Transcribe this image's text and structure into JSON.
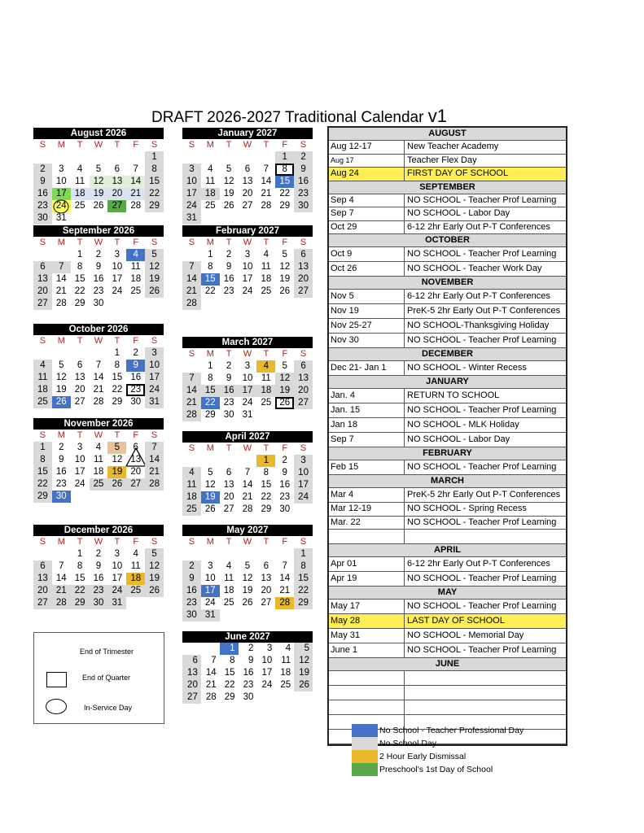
{
  "title": {
    "main": "DRAFT 2026-2027 Traditional Calendar ",
    "version": "v1"
  },
  "dow": [
    "S",
    "M",
    "T",
    "W",
    "T",
    "F",
    "S"
  ],
  "months": [
    {
      "name": "August  2026",
      "offset": 6,
      "days": 31,
      "styles": {
        "1": "gray",
        "2": "gray",
        "8": "gray",
        "9": "gray",
        "12": "lgreen",
        "13": "lgreen",
        "14": "lgreen",
        "15": "gray",
        "16": "gray",
        "17": "lime",
        "18": "lblue",
        "19": "lblue",
        "20": "lblue",
        "21": "lblue",
        "22": "gray",
        "23": "gray",
        "24": "yellow circled",
        "27": "green",
        "29": "gray",
        "30": "gray"
      }
    },
    {
      "name": "September  2026",
      "offset": 2,
      "days": 30,
      "styles": {
        "4": "blue",
        "5": "gray",
        "6": "gray",
        "7": "gray",
        "12": "gray",
        "13": "gray",
        "19": "gray",
        "20": "gray",
        "26": "gray",
        "27": "gray"
      }
    },
    {
      "name": "October  2026",
      "offset": 4,
      "days": 31,
      "styles": {
        "3": "gray",
        "4": "gray",
        "9": "blue",
        "10": "gray",
        "11": "gray",
        "17": "gray",
        "18": "gray",
        "23": "boxed",
        "24": "gray",
        "25": "gray",
        "26": "blue",
        "31": "gray"
      }
    },
    {
      "name": "November  2026",
      "offset": 0,
      "days": 30,
      "styles": {
        "1": "gray",
        "5": "tan",
        "7": "gray",
        "8": "gray",
        "13": "tri",
        "14": "gray",
        "15": "gray",
        "19": "gold",
        "21": "gray",
        "22": "gray",
        "25": "gray",
        "26": "gray",
        "27": "gray",
        "28": "gray",
        "29": "gray",
        "30": "blue"
      }
    },
    {
      "name": "December  2026",
      "offset": 2,
      "days": 31,
      "styles": {
        "5": "gray",
        "6": "gray",
        "12": "gray",
        "13": "gray",
        "18": "gold",
        "19": "gray",
        "20": "gray",
        "21": "gray",
        "22": "gray",
        "23": "gray",
        "24": "gray",
        "25": "gray",
        "26": "gray",
        "27": "gray",
        "28": "gray",
        "29": "gray",
        "30": "gray",
        "31": "gray"
      }
    },
    {
      "name": "January  2027",
      "offset": 5,
      "days": 31,
      "styles": {
        "1": "gray",
        "2": "gray",
        "3": "gray",
        "8": "boxed",
        "9": "gray",
        "10": "gray",
        "15": "blue",
        "16": "gray",
        "17": "gray",
        "18": "gray",
        "23": "gray",
        "24": "gray",
        "30": "gray",
        "31": "gray"
      }
    },
    {
      "name": "February  2027",
      "offset": 1,
      "days": 28,
      "styles": {
        "6": "gray",
        "7": "gray",
        "13": "gray",
        "14": "gray",
        "15": "blue",
        "20": "gray",
        "21": "gray",
        "27": "gray",
        "28": "gray"
      }
    },
    {
      "name": "March  2027",
      "offset": 1,
      "days": 31,
      "styles": {
        "4": "gold",
        "6": "gray",
        "7": "gray",
        "12": "gray",
        "13": "gray",
        "14": "gray",
        "15": "gray",
        "16": "gray",
        "17": "gray",
        "18": "gray",
        "19": "gray",
        "20": "gray",
        "21": "gray",
        "22": "blue",
        "26": "boxed",
        "27": "gray",
        "28": "gray"
      }
    },
    {
      "name": "April  2027",
      "offset": 4,
      "days": 30,
      "styles": {
        "1": "gold",
        "3": "gray",
        "4": "gray",
        "10": "gray",
        "11": "gray",
        "17": "gray",
        "18": "gray",
        "19": "blue",
        "24": "gray",
        "25": "gray"
      }
    },
    {
      "name": "May  2027",
      "offset": 6,
      "days": 31,
      "styles": {
        "1": "gray",
        "2": "gray",
        "8": "gray",
        "9": "gray",
        "15": "gray",
        "16": "gray",
        "17": "blue",
        "22": "gray",
        "23": "gray",
        "28": "gold",
        "29": "gray",
        "30": "gray",
        "31": "gray"
      }
    },
    {
      "name": "June 2027",
      "offset": 2,
      "days": 30,
      "nodow": true,
      "styles": {
        "1": "blue",
        "5": "gray",
        "6": "gray",
        "12": "gray",
        "13": "gray",
        "19": "gray",
        "20": "gray",
        "26": "gray",
        "27": "gray"
      }
    }
  ],
  "events": [
    {
      "section": "AUGUST"
    },
    {
      "date": "Aug 12-17",
      "event": "New Teacher Academy"
    },
    {
      "date": "Aug 17",
      "event": "Teacher Flex Day",
      "small": true
    },
    {
      "date": "Aug 24",
      "event": "FIRST DAY OF SCHOOL",
      "highlight": true
    },
    {
      "section": "SEPTEMBER"
    },
    {
      "date": "Sep 4",
      "event": "NO SCHOOL - Teacher Prof Learning"
    },
    {
      "date": "Sep 7",
      "event": "NO SCHOOL - Labor Day"
    },
    {
      "date": "Oct 29",
      "event": "6-12 2hr Early Out P-T Conferences"
    },
    {
      "section": "OCTOBER"
    },
    {
      "date": "Oct 9",
      "event": "NO SCHOOL - Teacher Prof Learning",
      "tall": true
    },
    {
      "date": "Oct 26",
      "event": "NO SCHOOL - Teacher Work Day",
      "tall": true
    },
    {
      "section": "NOVEMBER"
    },
    {
      "date": "Nov 5",
      "event": "6-12 2hr Early Out P-T Conferences",
      "tall": true
    },
    {
      "date": "Nov 19",
      "event": "PreK-5 2hr Early Out P-T Conferences",
      "tall": true
    },
    {
      "date": "Nov 25-27",
      "event": "NO SCHOOL-Thanksgiving Holiday",
      "tall": true
    },
    {
      "date": "Nov 30",
      "event": "NO SCHOOL - Teacher Prof Learning",
      "tall": true
    },
    {
      "section": "DECEMBER"
    },
    {
      "date": "Dec 21- Jan 1",
      "event": "NO SCHOOL - Winter Recess",
      "tall": true
    },
    {
      "section": "JANUARY"
    },
    {
      "date": "Jan. 4",
      "event": "RETURN TO SCHOOL",
      "tall": true
    },
    {
      "date": "Jan. 15",
      "event": "NO SCHOOL - Teacher Prof Learning",
      "tall": true
    },
    {
      "date": "Jan 18",
      "event": "NO SCHOOL - MLK Holiday",
      "tall": true
    },
    {
      "date": "Sep 7",
      "event": "NO SCHOOL - Labor Day",
      "tall": true
    },
    {
      "section": "FEBRUARY"
    },
    {
      "date": "Feb 15",
      "event": "NO SCHOOL - Teacher Prof Learning",
      "tall": true
    },
    {
      "section": "MARCH"
    },
    {
      "date": "Mar 4",
      "event": "PreK-5 2hr Early Out P-T Conferences",
      "tall": true
    },
    {
      "date": "Mar 12-19",
      "event": "NO SCHOOL - Spring Recess"
    },
    {
      "date": "Mar. 22",
      "event": "NO SCHOOL - Teacher Prof Learning"
    },
    {
      "date": "",
      "event": "",
      "tall": true
    },
    {
      "section": "APRIL"
    },
    {
      "date": "Apr 01",
      "event": "6-12 2hr Early Out P-T Conferences",
      "tall": true
    },
    {
      "date": "Apr 19",
      "event": "NO SCHOOL - Teacher Prof Learning",
      "tall": true
    },
    {
      "section": "MAY"
    },
    {
      "date": "May 17",
      "event": "NO SCHOOL - Teacher Prof Learning",
      "tall": true
    },
    {
      "date": "May 28",
      "event": "LAST DAY OF SCHOOL",
      "highlight": true,
      "tall": true
    },
    {
      "date": "May 31",
      "event": "NO SCHOOL - Memorial Day",
      "tall": true
    },
    {
      "date": "June 1",
      "event": "NO SCHOOL - Teacher Prof Learning",
      "tall": true
    },
    {
      "section": "JUNE"
    },
    {
      "date": "",
      "event": "",
      "tall": true
    },
    {
      "date": "",
      "event": "",
      "tall": true
    },
    {
      "date": "",
      "event": "",
      "tall": true
    },
    {
      "date": "",
      "event": "",
      "tall": true
    },
    {
      "date": "",
      "event": "",
      "tall": true
    }
  ],
  "key": {
    "trimester": "End of Trimester",
    "quarter": "End of Quarter",
    "inservice": "In-Service Day"
  },
  "legend": [
    {
      "label": "No School - Teacher Professional Day",
      "color": "#4472c4"
    },
    {
      "label": "No School Day",
      "color": "#d9d9d9"
    },
    {
      "label": "2 Hour Early Dismissal",
      "color": "#e8b92a"
    },
    {
      "label": "Preschool's 1st Day of School",
      "color": "#5aa84a"
    }
  ]
}
